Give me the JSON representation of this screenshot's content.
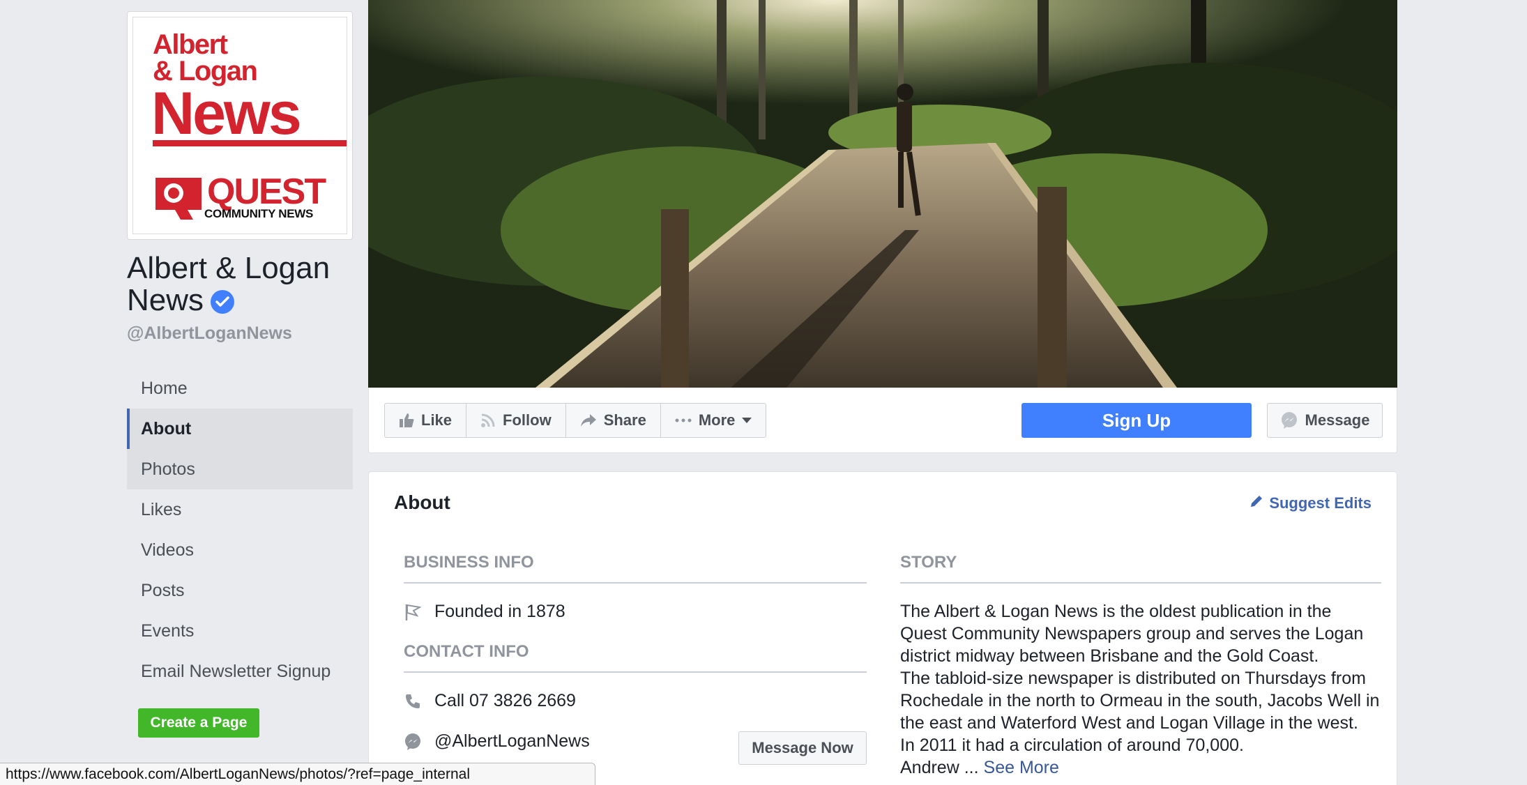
{
  "profile": {
    "logo_line1": "Albert",
    "logo_line2": "& Logan",
    "logo_news": "News",
    "logo_quest": "QUEST",
    "logo_community": "COMMUNITY NEWS",
    "name_line1": "Albert & Logan",
    "name_line2": "News",
    "username": "@AlbertLoganNews"
  },
  "nav": {
    "items": [
      {
        "label": "Home"
      },
      {
        "label": "About"
      },
      {
        "label": "Photos"
      },
      {
        "label": "Likes"
      },
      {
        "label": "Videos"
      },
      {
        "label": "Posts"
      },
      {
        "label": "Events"
      },
      {
        "label": "Email Newsletter Signup"
      }
    ],
    "active": "About",
    "hover": "Photos"
  },
  "create_page_label": "Create a Page",
  "actions": {
    "like": "Like",
    "follow": "Follow",
    "share": "Share",
    "more": "More",
    "signup": "Sign Up",
    "message": "Message"
  },
  "about": {
    "title": "About",
    "suggest_edits": "Suggest Edits",
    "business_info_heading": "BUSINESS INFO",
    "founded": "Founded in 1878",
    "contact_info_heading": "CONTACT INFO",
    "phone": "Call 07 3826 2669",
    "messenger": "@AlbertLoganNews",
    "message_now": "Message Now",
    "story_heading": "STORY",
    "story_p1": "The Albert & Logan News is the oldest publication in the Quest Community Newspapers group and serves the Logan district midway between Brisbane and the Gold Coast.",
    "story_p2": "The tabloid-size newspaper is distributed on Thursdays from Rochedale in the north to Ormeau in the south, Jacobs Well in the east and Waterford West and Logan Village in the west.",
    "story_p3": "In 2011 it had a circulation of around 70,000.",
    "story_p4": "Andrew ...",
    "see_more": "See More"
  },
  "status_url": "https://www.facebook.com/AlbertLoganNews/photos/?ref=page_internal",
  "colors": {
    "brand_red": "#d2232e",
    "facebook_blue": "#4080ff",
    "link_blue": "#4267b2",
    "create_green": "#42b72a",
    "page_bg": "#e9ebee"
  },
  "icons": {
    "verified": "verified-badge-icon",
    "like": "thumbs-up-icon",
    "follow": "rss-icon",
    "share": "share-arrow-icon",
    "more": "ellipsis-icon",
    "message": "messenger-icon",
    "suggest": "pencil-icon",
    "founded": "flag-icon",
    "phone": "phone-icon",
    "messenger": "messenger-icon"
  }
}
